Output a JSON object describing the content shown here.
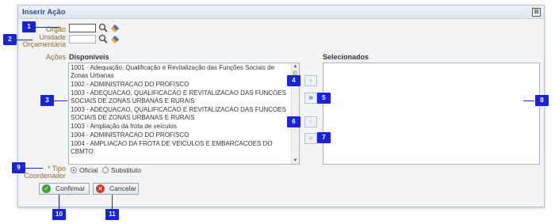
{
  "dialog": {
    "title": "Inserir Ação",
    "close_label": "⊠"
  },
  "form": {
    "orgao_label": "Orgão",
    "orgao_value": "",
    "unidade_label_line1": "Unidade",
    "unidade_label_line2": "Orçamentária",
    "unidade_value": "",
    "acoes_label": "Ações",
    "disponiveis_label": "Disponíveis",
    "selecionados_label": "Selecionados",
    "tipo_label_line1": "* Tipo",
    "tipo_label_line2": "Coordenador",
    "tipo_options": [
      "Oficial",
      "Substituto"
    ],
    "tipo_selected": "Oficial"
  },
  "available_items": [
    "1001 - Adequação, Qualificação e Revitalização das Funções Sociais de Zonas Urbanas",
    "1002 - ADMINISTRACAO DO PROFISCO",
    "1003 - ADEQUACAO, QUALIFICACAO E REVITALIZACAO DAS FUNCOES SOCIAIS DE ZONAS URBANAS E RURAIS",
    "1003 - ADEQUACAO, QUALIFICACAO E REVITALIZACAO DAS FUNCOES SOCIAIS DE ZONAS URBANAS E RURAIS",
    "1003 - Ampliação da frota de veículos",
    "1004 - ADMINISTRACAO DO PROFISCO",
    "1004 - AMPLIACAO DA FROTA DE VEICULOS E EMBARCACOES DO CBMTO"
  ],
  "move_buttons": {
    "add_one": "›",
    "add_all": "»",
    "remove_one": "‹",
    "remove_all": "«"
  },
  "buttons": {
    "confirm": "Confirmar",
    "cancel": "Cancelar"
  },
  "callouts": [
    "1",
    "2",
    "3",
    "4",
    "5",
    "6",
    "7",
    "8",
    "9",
    "10",
    "11"
  ],
  "colors": {
    "callout": "#1a24d6",
    "title": "#2b4e8c",
    "label": "#8b6b2c",
    "confirm_icon": "#3aa33a",
    "cancel_icon": "#d23a2a"
  }
}
